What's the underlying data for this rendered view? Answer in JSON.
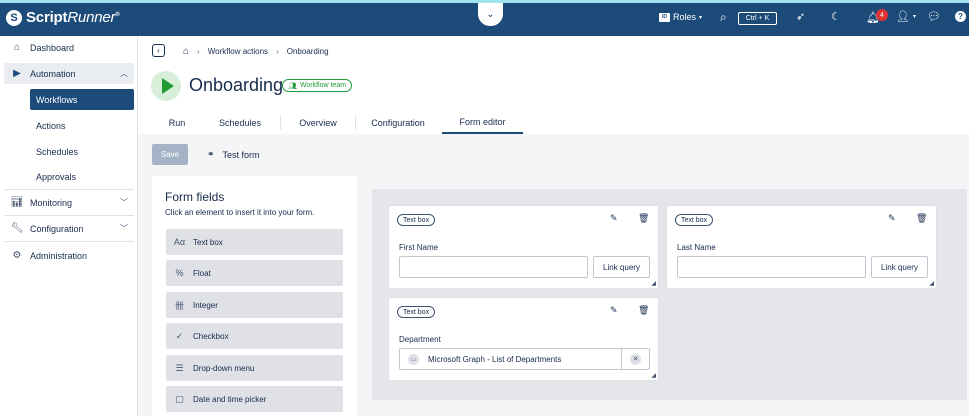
{
  "app": {
    "logo_name": "ScriptRunner",
    "logo_bold": "Script",
    "logo_italic": "Runner",
    "logo_mark": "®"
  },
  "topbar": {
    "roles_label": "Roles",
    "search_shortcut": "Ctrl + K",
    "notification_count": "4"
  },
  "sidebar": {
    "dashboard": "Dashboard",
    "automation": "Automation",
    "workflows": "Workflows",
    "actions": "Actions",
    "schedules": "Schedules",
    "approvals": "Approvals",
    "monitoring": "Monitoring",
    "configuration": "Configuration",
    "administration": "Administration"
  },
  "breadcrumb": {
    "item1": "Workflow actions",
    "item2": "Onboarding"
  },
  "page": {
    "title": "Onboarding",
    "team_badge": "Workflow team"
  },
  "tabs": [
    "Run",
    "Schedules",
    "Overview",
    "Configuration",
    "Form editor"
  ],
  "active_tab": "Form editor",
  "toolbar": {
    "save_label": "Save",
    "test_form_label": "Test form"
  },
  "palette": {
    "title": "Form fields",
    "subtitle": "Click an element to insert it into your form.",
    "items": [
      {
        "label": "Text box",
        "icon": "text-box-icon",
        "glyph": "Aα"
      },
      {
        "label": "Float",
        "icon": "percent-icon",
        "glyph": "%"
      },
      {
        "label": "Integer",
        "icon": "tally-icon",
        "glyph": "卌"
      },
      {
        "label": "Checkbox",
        "icon": "check-icon",
        "glyph": "✓"
      },
      {
        "label": "Drop-down menu",
        "icon": "list-icon",
        "glyph": "☰"
      },
      {
        "label": "Date and time picker",
        "icon": "calendar-icon",
        "glyph": "▢"
      }
    ]
  },
  "form_cards": [
    {
      "chip": "Text box",
      "label": "First Name",
      "button": "Link query"
    },
    {
      "chip": "Text box",
      "label": "Last Name",
      "button": "Link query"
    },
    {
      "chip": "Text box",
      "label": "Department",
      "select_value": "Microsoft Graph - List of Departments"
    }
  ],
  "colors": {
    "header": "#1c4b7a",
    "accent_green": "#1f9a35",
    "active_nav": "#1c4b7a"
  }
}
